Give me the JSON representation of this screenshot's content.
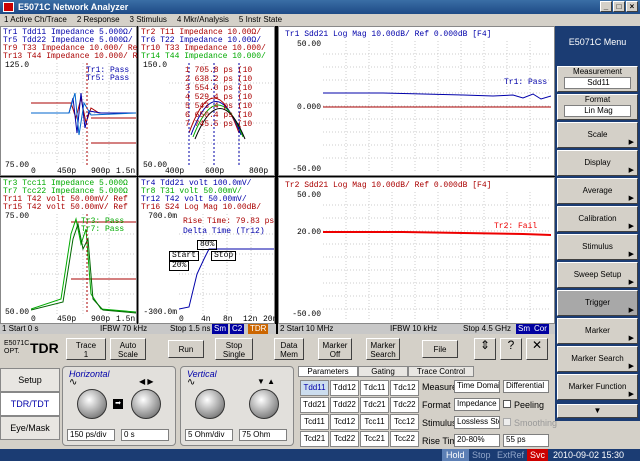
{
  "window": {
    "title": "E5071C Network Analyzer"
  },
  "menu": [
    "1 Active Ch/Trace",
    "2 Response",
    "3 Stimulus",
    "4 Mkr/Analysis",
    "5 Instr State"
  ],
  "channels": {
    "ch1": {
      "p1_traces": [
        "Tr1 Tdd11 Impedance 5.000Ω/ Ref",
        "Tr5 Tdd22 Impedance 5.000Ω/ Ref",
        "Tr9 T33 Impedance 10.000/ Ref",
        "Tr13 T44 Impedance 10.000/ Ref"
      ],
      "p1_mark": [
        "Tr1: Pass",
        "Tr5: Pass"
      ],
      "p1_y": [
        "125.0",
        "120.0",
        "115.0",
        "110.0",
        "105.0",
        "100.0",
        "95.00",
        "90.00",
        "85.00",
        "80.00",
        "75.00"
      ],
      "p1_x": [
        "0",
        "450p",
        "900p",
        "1.5n"
      ],
      "p2_traces": [
        "Tr2 T11 Impedance 10.00Ω/",
        "Tr6 T22 Impedance 10.00Ω/",
        "Tr10 T33 Impedance 10.000/",
        "Tr14 T44 Impedance 10.000/"
      ],
      "p2_y": [
        "150.0",
        "140.0",
        "130.0",
        "120.0",
        "110.0",
        "100.0",
        "90.00",
        "80.00",
        "70.00",
        "60.00",
        "50.00"
      ],
      "p2_x": [
        "400p",
        "600p",
        "800p"
      ],
      "p2_markers": [
        "1  705.8 ps (10",
        "2  638.2 ps (10",
        "3  554.0 ps (10",
        "4  529.4 ps (10",
        "5  543.4 ps (10",
        "6  650.4 ps (10",
        "7  745.5 ps (10"
      ],
      "p3_traces": [
        "Tr3 Tcc11 Impedance 5.000Ω",
        "Tr7 Tcc22 Impedance 5.000Ω",
        "Tr11 T42 volt 50.00mV/ Ref",
        "Tr15 T42 volt 50.00mV/ Ref"
      ],
      "p3_mark": [
        "Tr3: Pass",
        "Tr7: Pass"
      ],
      "p3_y": [
        "75.00",
        "72.50",
        "70.00",
        "67.50",
        "65.00",
        "62.50",
        "60.00",
        "57.50",
        "55.00",
        "52.50",
        "50.00"
      ],
      "p3_x": [
        "0",
        "450p",
        "900p",
        "1.5n"
      ],
      "p4_traces": [
        "Tr4 Tdd21 volt 100.0mV/",
        "Tr8 T31 volt 50.00mV/",
        "Tr12 T42 volt 50.00mV/",
        "Tr16 S24 Log Mag 10.00dB/"
      ],
      "p4_y": [
        "700.0m",
        "600.0m",
        "500.0m",
        "400.0m",
        "300.0m",
        "200.0m",
        "100.0m",
        "0.000",
        "-100.0m",
        "-200.0m",
        "-300.0m"
      ],
      "p4_x": [
        "0",
        "4n",
        "8n",
        "12n",
        "20n"
      ],
      "p4_rise": "Rise Time: 79.83 ps",
      "p4_delta": "Delta Time (Tr12)",
      "p4_labels": [
        "80%",
        "Start",
        "Stop",
        "20%"
      ],
      "status": {
        "start": "1  Start 0 s",
        "ifbw": "IFBW 70 kHz",
        "stop": "Stop 1.5 ns",
        "sm": "Sm",
        "c2": "C2",
        "tdr": "TDR"
      }
    },
    "ch2": {
      "top_title": "Tr1 Sdd21 Log Mag 10.00dB/ Ref 0.000dB [F4]",
      "top_pass": "Tr1: Pass",
      "top_y": [
        "50.00",
        "40.00",
        "30.00",
        "20.00",
        "10.00",
        "0.000",
        "-10.00",
        "-20.00",
        "-30.00",
        "-40.00",
        "-50.00"
      ],
      "bot_title": "Tr2 Sdd21 Log Mag 10.00dB/ Ref 0.000dB [F4]",
      "bot_fail": "Tr2: Fail",
      "bot_y": [
        "50.00",
        "40.00",
        "30.00",
        "20.00",
        "10.00",
        "0.000",
        "-10.00",
        "-20.00",
        "-30.00",
        "-40.00",
        "-50.00"
      ],
      "status": {
        "start": "2  Start 10 MHz",
        "ifbw": "IFBW 10 kHz",
        "stop": "Stop 4.5 GHz",
        "sm": "Sm",
        "cor": "Cor"
      }
    }
  },
  "right_menu": {
    "title": "E5071C Menu",
    "measurement_label": "Measurement",
    "measurement_value": "Sdd11",
    "format_label": "Format",
    "format_value": "Lin Mag",
    "items": [
      "Scale",
      "Display",
      "Average",
      "Calibration",
      "Stimulus",
      "Sweep Setup",
      "Trigger",
      "Marker",
      "Marker Search",
      "Marker Function"
    ]
  },
  "tdr": {
    "brand": "E5071C",
    "brand_sub": "OPT.",
    "brand_big": "TDR",
    "buttons": {
      "trace": "Trace",
      "trace_num": "1",
      "auto_scale": "Auto\nScale",
      "run": "Run",
      "stop_single": "Stop\nSingle",
      "data_mem": "Data\nMem",
      "marker_off": "Marker\nOff",
      "marker_search": "Marker\nSearch",
      "file": "File"
    },
    "left_tabs": [
      "Setup",
      "TDR/TDT",
      "Eye/Mask"
    ],
    "horizontal": {
      "title": "Horizontal",
      "value1": "150 ps/div",
      "value2": "0 s"
    },
    "vertical": {
      "title": "Vertical",
      "value1": "5 Ohm/div",
      "value2": "75 Ohm"
    },
    "tabs": [
      "Parameters",
      "Gating",
      "Trace Control"
    ],
    "grid": [
      [
        "Tdd11",
        "Tdd12",
        "Tdc11",
        "Tdc12"
      ],
      [
        "Tdd21",
        "Tdd22",
        "Tdc21",
        "Tdc22"
      ],
      [
        "Tcd11",
        "Tcd12",
        "Tcc11",
        "Tcc12"
      ],
      [
        "Tcd21",
        "Tcd22",
        "Tcc21",
        "Tcc22"
      ]
    ],
    "measure_label": "Measure",
    "measure_value": "Time Domain",
    "measure_value2": "Differential",
    "format_label": "Format",
    "format_value": "Impedance",
    "peeling": "Peeling",
    "stimulus_label": "Stimulus",
    "stimulus_value": "Lossless Step",
    "smoothing": "Smoothing",
    "rise_label": "Rise Time",
    "rise_value": "20-80%",
    "rise_ps": "55 ps"
  },
  "statusline": {
    "hold": "Hold",
    "stop": "Stop",
    "extref": "ExtRef",
    "svc": "Svc",
    "datetime": "2010-09-02 15:30"
  }
}
